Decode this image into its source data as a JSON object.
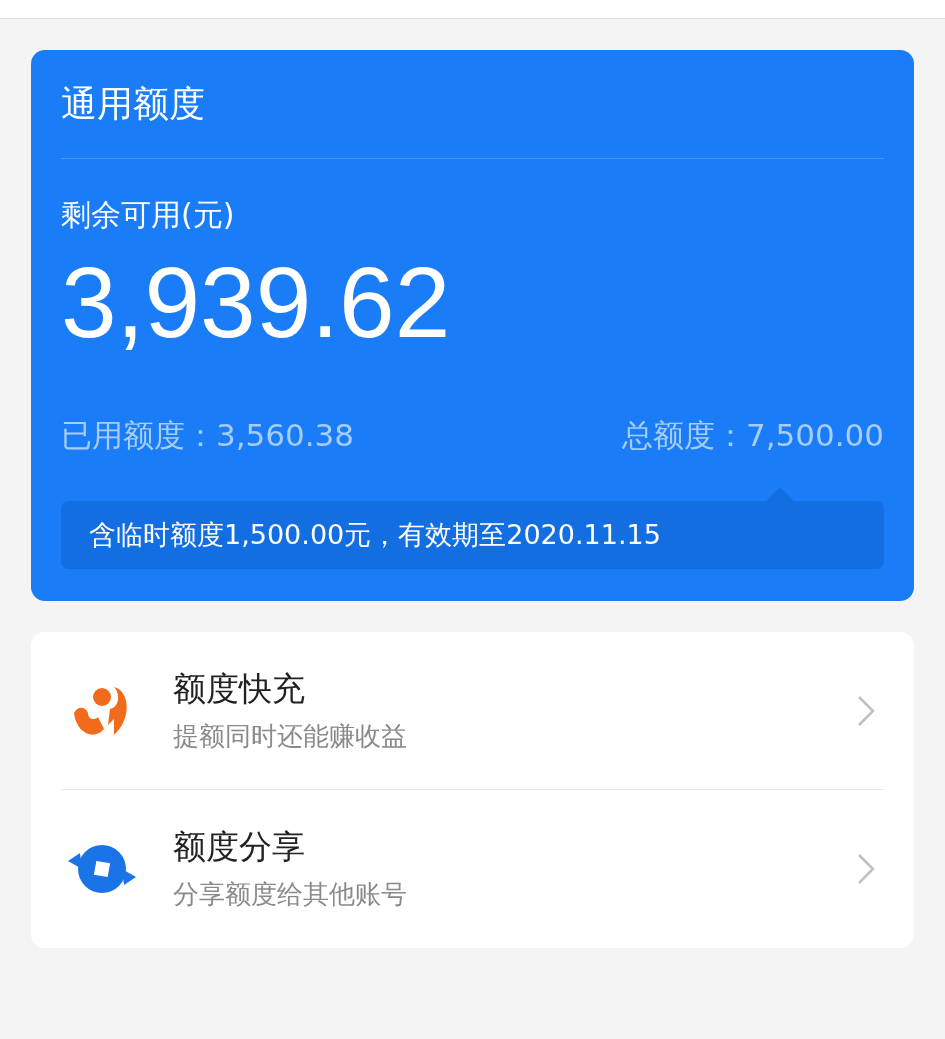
{
  "quota_card": {
    "title": "通用额度",
    "available_label": "剩余可用(元)",
    "available_amount": "3,939.62",
    "used": "已用额度：3,560.38",
    "total": "总额度：7,500.00",
    "note": "含临时额度1,500.00元，有效期至2020.11.15"
  },
  "services": [
    {
      "title": "额度快充",
      "subtitle": "提额同时还能赚收益"
    },
    {
      "title": "额度分享",
      "subtitle": "分享额度给其他账号"
    }
  ]
}
